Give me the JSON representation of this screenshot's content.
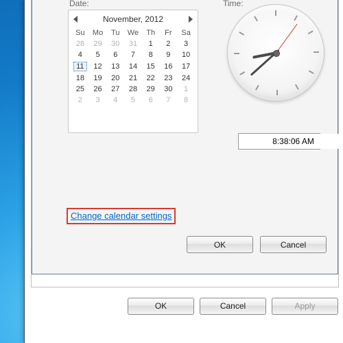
{
  "labels": {
    "date": "Date:",
    "time": "Time:"
  },
  "calendar": {
    "title": "November, 2012",
    "dow": [
      "Su",
      "Mo",
      "Tu",
      "We",
      "Th",
      "Fr",
      "Sa"
    ],
    "rows": [
      [
        {
          "d": "28",
          "dim": true
        },
        {
          "d": "29",
          "dim": true
        },
        {
          "d": "30",
          "dim": true
        },
        {
          "d": "31",
          "dim": true
        },
        {
          "d": "1"
        },
        {
          "d": "2"
        },
        {
          "d": "3"
        }
      ],
      [
        {
          "d": "4"
        },
        {
          "d": "5"
        },
        {
          "d": "6"
        },
        {
          "d": "7"
        },
        {
          "d": "8"
        },
        {
          "d": "9"
        },
        {
          "d": "10"
        }
      ],
      [
        {
          "d": "11",
          "sel": true
        },
        {
          "d": "12"
        },
        {
          "d": "13"
        },
        {
          "d": "14"
        },
        {
          "d": "15"
        },
        {
          "d": "16"
        },
        {
          "d": "17"
        }
      ],
      [
        {
          "d": "18"
        },
        {
          "d": "19"
        },
        {
          "d": "20"
        },
        {
          "d": "21"
        },
        {
          "d": "22"
        },
        {
          "d": "23"
        },
        {
          "d": "24"
        }
      ],
      [
        {
          "d": "25"
        },
        {
          "d": "26"
        },
        {
          "d": "27"
        },
        {
          "d": "28"
        },
        {
          "d": "29"
        },
        {
          "d": "30"
        },
        {
          "d": "1",
          "dim": true
        }
      ],
      [
        {
          "d": "2",
          "dim": true
        },
        {
          "d": "3",
          "dim": true
        },
        {
          "d": "4",
          "dim": true
        },
        {
          "d": "5",
          "dim": true
        },
        {
          "d": "6",
          "dim": true
        },
        {
          "d": "7",
          "dim": true
        },
        {
          "d": "8",
          "dim": true
        }
      ]
    ]
  },
  "time": {
    "value": "8:38:06 AM",
    "hourAngle": 259,
    "minAngle": 228,
    "secAngle": 36
  },
  "link": {
    "text": "Change calendar settings"
  },
  "innerButtons": {
    "ok": "OK",
    "cancel": "Cancel"
  },
  "outerButtons": {
    "ok": "OK",
    "cancel": "Cancel",
    "apply": "Apply"
  }
}
